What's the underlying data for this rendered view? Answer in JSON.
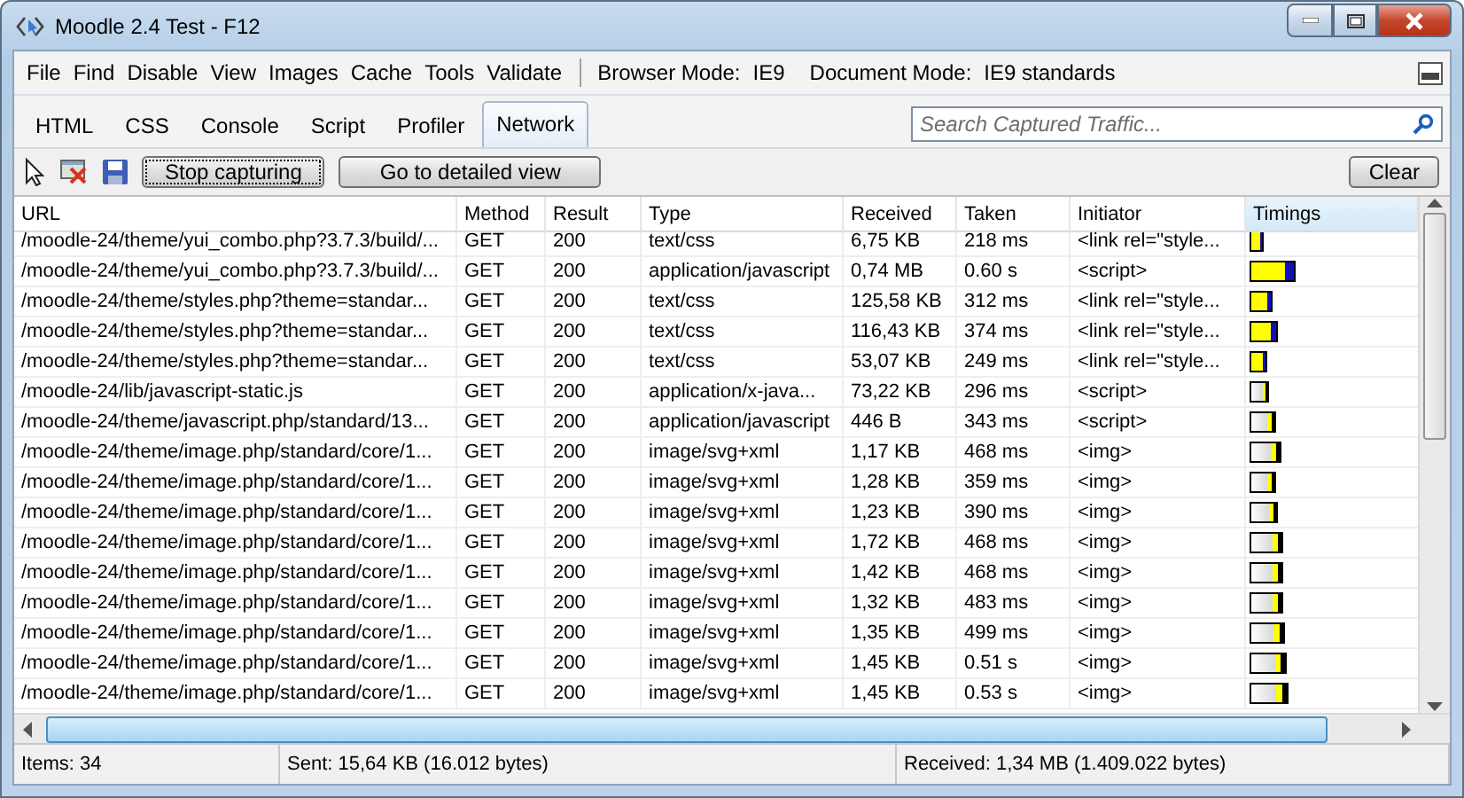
{
  "window": {
    "title": "Moodle 2.4 Test - F12"
  },
  "menu": [
    {
      "label": "File"
    },
    {
      "label": "Find"
    },
    {
      "label": "Disable"
    },
    {
      "label": "View"
    },
    {
      "label": "Images"
    },
    {
      "label": "Cache"
    },
    {
      "label": "Tools"
    },
    {
      "label": "Validate"
    }
  ],
  "modes": [
    {
      "label": "Browser Mode:",
      "value": "IE9"
    },
    {
      "label": "Document Mode:",
      "value": "IE9 standards"
    }
  ],
  "tabs": [
    {
      "label": "HTML",
      "selected": false
    },
    {
      "label": "CSS",
      "selected": false
    },
    {
      "label": "Console",
      "selected": false
    },
    {
      "label": "Script",
      "selected": false
    },
    {
      "label": "Profiler",
      "selected": false
    },
    {
      "label": "Network",
      "selected": true
    }
  ],
  "search": {
    "placeholder": "Search Captured Traffic..."
  },
  "toolbar": {
    "buttons": [
      {
        "label": "Stop capturing",
        "focused": true
      },
      {
        "label": "Go to detailed view",
        "focused": false
      }
    ],
    "clear": "Clear"
  },
  "table": {
    "columns": [
      "URL",
      "Method",
      "Result",
      "Type",
      "Received",
      "Taken",
      "Initiator",
      "Timings"
    ],
    "rows": [
      {
        "cells": [
          "/moodle-24/theme/yui_combo.php?3.7.3/build/...",
          "GET",
          "200",
          "text/css",
          "6,75 KB",
          "218 ms",
          "<link rel=\"style..."
        ],
        "timing": {
          "kind": "download",
          "level": 0.08
        }
      },
      {
        "cells": [
          "/moodle-24/theme/yui_combo.php?3.7.3/build/...",
          "GET",
          "200",
          "application/javascript",
          "0,74 MB",
          "0.60 s",
          "<script>"
        ],
        "timing": {
          "kind": "download",
          "level": 0.27
        }
      },
      {
        "cells": [
          "/moodle-24/theme/styles.php?theme=standar...",
          "GET",
          "200",
          "text/css",
          "125,58 KB",
          "312 ms",
          "<link rel=\"style..."
        ],
        "timing": {
          "kind": "download",
          "level": 0.13
        }
      },
      {
        "cells": [
          "/moodle-24/theme/styles.php?theme=standar...",
          "GET",
          "200",
          "text/css",
          "116,43 KB",
          "374 ms",
          "<link rel=\"style..."
        ],
        "timing": {
          "kind": "download",
          "level": 0.16
        }
      },
      {
        "cells": [
          "/moodle-24/theme/styles.php?theme=standar...",
          "GET",
          "200",
          "text/css",
          "53,07 KB",
          "249 ms",
          "<link rel=\"style..."
        ],
        "timing": {
          "kind": "download",
          "level": 0.1
        }
      },
      {
        "cells": [
          "/moodle-24/lib/javascript-static.js",
          "GET",
          "200",
          "application/x-java...",
          "73,22 KB",
          "296 ms",
          "<script>"
        ],
        "timing": {
          "kind": "wait",
          "level": 0.11
        }
      },
      {
        "cells": [
          "/moodle-24/theme/javascript.php/standard/13...",
          "GET",
          "200",
          "application/javascript",
          "446 B",
          "343 ms",
          "<script>"
        ],
        "timing": {
          "kind": "wait",
          "level": 0.15
        }
      },
      {
        "cells": [
          "/moodle-24/theme/image.php/standard/core/1...",
          "GET",
          "200",
          "image/svg+xml",
          "1,17 KB",
          "468 ms",
          "<img>"
        ],
        "timing": {
          "kind": "wait",
          "level": 0.19
        }
      },
      {
        "cells": [
          "/moodle-24/theme/image.php/standard/core/1...",
          "GET",
          "200",
          "image/svg+xml",
          "1,28 KB",
          "359 ms",
          "<img>"
        ],
        "timing": {
          "kind": "wait",
          "level": 0.15
        }
      },
      {
        "cells": [
          "/moodle-24/theme/image.php/standard/core/1...",
          "GET",
          "200",
          "image/svg+xml",
          "1,23 KB",
          "390 ms",
          "<img>"
        ],
        "timing": {
          "kind": "wait",
          "level": 0.17
        }
      },
      {
        "cells": [
          "/moodle-24/theme/image.php/standard/core/1...",
          "GET",
          "200",
          "image/svg+xml",
          "1,72 KB",
          "468 ms",
          "<img>"
        ],
        "timing": {
          "kind": "wait",
          "level": 0.2
        }
      },
      {
        "cells": [
          "/moodle-24/theme/image.php/standard/core/1...",
          "GET",
          "200",
          "image/svg+xml",
          "1,42 KB",
          "468 ms",
          "<img>"
        ],
        "timing": {
          "kind": "wait",
          "level": 0.2
        }
      },
      {
        "cells": [
          "/moodle-24/theme/image.php/standard/core/1...",
          "GET",
          "200",
          "image/svg+xml",
          "1,32 KB",
          "483 ms",
          "<img>"
        ],
        "timing": {
          "kind": "wait",
          "level": 0.2
        }
      },
      {
        "cells": [
          "/moodle-24/theme/image.php/standard/core/1...",
          "GET",
          "200",
          "image/svg+xml",
          "1,35 KB",
          "499 ms",
          "<img>"
        ],
        "timing": {
          "kind": "wait",
          "level": 0.21
        }
      },
      {
        "cells": [
          "/moodle-24/theme/image.php/standard/core/1...",
          "GET",
          "200",
          "image/svg+xml",
          "1,45 KB",
          "0.51 s",
          "<img>"
        ],
        "timing": {
          "kind": "wait",
          "level": 0.22
        }
      },
      {
        "cells": [
          "/moodle-24/theme/image.php/standard/core/1...",
          "GET",
          "200",
          "image/svg+xml",
          "1,45 KB",
          "0.53 s",
          "<img>"
        ],
        "timing": {
          "kind": "wait",
          "level": 0.23
        }
      }
    ]
  },
  "status_bar": [
    "Items: 34",
    "Sent: 15,64 KB (16.012 bytes)",
    "Received: 1,34 MB (1.409.022 bytes)"
  ]
}
